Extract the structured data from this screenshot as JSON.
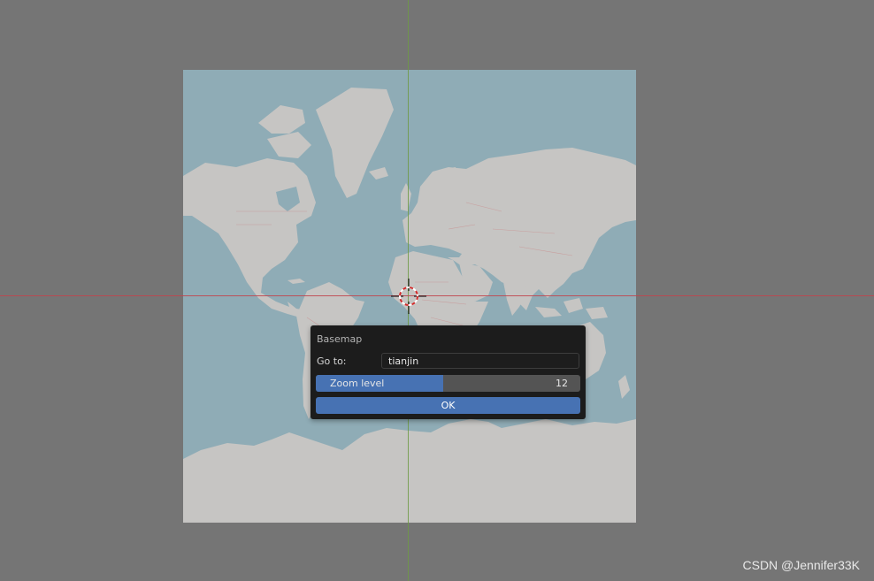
{
  "colors": {
    "background": "#757575",
    "ocean": "#8facb6",
    "land": "#c6c5c3",
    "accent": "#4772b3",
    "dialog_bg": "#1c1c1c"
  },
  "dialog": {
    "title": "Basemap",
    "goto_label": "Go to:",
    "goto_value": "tianjin",
    "zoom_label": "Zoom level",
    "zoom_value": "12",
    "zoom_fraction": 0.48,
    "ok_label": "OK"
  },
  "icons": {
    "cursor": "3d-cursor-icon"
  },
  "watermark": "CSDN @Jennifer33K"
}
